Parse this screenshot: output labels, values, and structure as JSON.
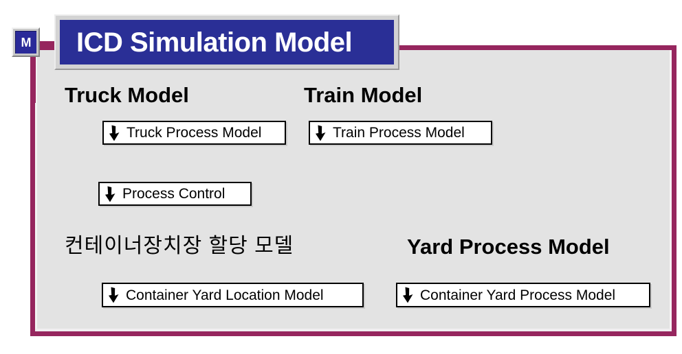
{
  "page": {
    "background_color": "#ffffff",
    "panel_color": "#e3e3e3",
    "frame_color": "#96265e",
    "title_box_color": "#2a2f96",
    "title_bevel_color": "#d3d3d3"
  },
  "root_icon": {
    "label": "M",
    "name": "model-root-icon"
  },
  "title": {
    "text": "ICD Simulation Model"
  },
  "sections": [
    {
      "id": "truck",
      "label": "Truck Model",
      "lang": "en"
    },
    {
      "id": "train",
      "label": "Train Model",
      "lang": "en"
    },
    {
      "id": "yard_alloc",
      "label": "컨테이너장치장 할당 모델",
      "lang": "kr"
    },
    {
      "id": "yard_process",
      "label": "Yard Process Model",
      "lang": "en"
    }
  ],
  "nodes": [
    {
      "id": "truck_process",
      "label": "Truck Process Model",
      "icon": "down-arrow-icon"
    },
    {
      "id": "train_process",
      "label": "Train Process Model",
      "icon": "down-arrow-icon"
    },
    {
      "id": "process_control",
      "label": "Process Control",
      "icon": "down-arrow-icon"
    },
    {
      "id": "container_yard_location",
      "label": "Container Yard Location Model",
      "icon": "down-arrow-icon"
    },
    {
      "id": "container_yard_process",
      "label": "Container Yard Process Model",
      "icon": "down-arrow-icon"
    }
  ]
}
